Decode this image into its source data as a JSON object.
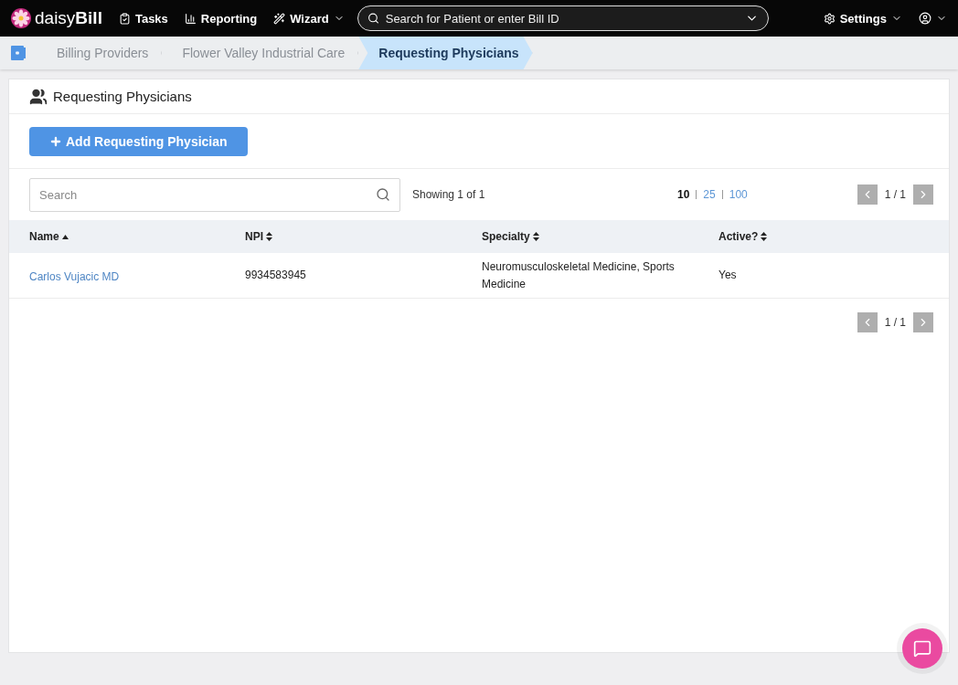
{
  "nav": {
    "brand_light": "daisy",
    "brand_bold": "Bill",
    "items": [
      {
        "label": "Tasks",
        "kind": "tasks"
      },
      {
        "label": "Reporting",
        "kind": "reporting"
      },
      {
        "label": "Wizard",
        "kind": "wizard"
      }
    ],
    "search": {
      "placeholder": "Search for Patient or enter Bill ID"
    },
    "settings": "Settings"
  },
  "breadcrumbs": [
    {
      "label": "Billing Providers",
      "selected": false
    },
    {
      "label": "Flower Valley Industrial Care",
      "selected": false
    },
    {
      "label": "Requesting Physicians",
      "selected": true
    }
  ],
  "panel": {
    "title": "Requesting Physicians",
    "add_button": "Add Requesting Physician",
    "search": {
      "placeholder": "Search"
    },
    "showing": "Showing 1 of 1",
    "page_sizes": [
      {
        "label": "10",
        "selected": true
      },
      {
        "label": "25",
        "selected": false
      },
      {
        "label": "100",
        "selected": false
      }
    ],
    "pager": "1 / 1",
    "columns": [
      {
        "label": "Name",
        "sorted": true
      },
      {
        "label": "NPI",
        "sorted": false
      },
      {
        "label": "Specialty",
        "sorted": false
      },
      {
        "label": "Active?",
        "sorted": false
      }
    ],
    "rows": [
      {
        "name": "Carlos Vujacic MD",
        "npi": "9934583945",
        "specialty": "Neuromusculoskeletal Medicine, Sports Medicine",
        "active": "Yes"
      }
    ],
    "pager_bottom": "1 / 1"
  }
}
